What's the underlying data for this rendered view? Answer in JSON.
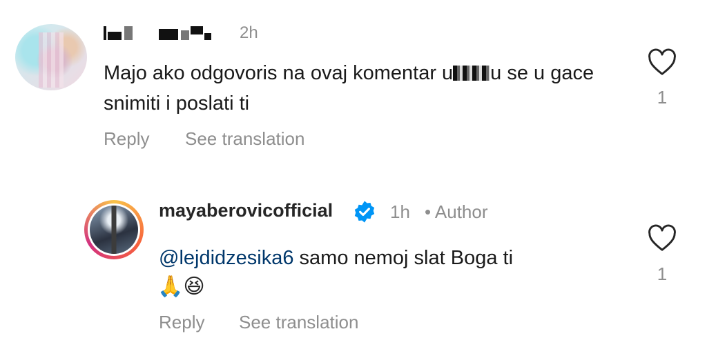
{
  "comment1": {
    "time": "2h",
    "text_part1": "Majo ako odgovoris na ovaj komentar u",
    "text_part2": "u se u gace snimiti i poslati ti",
    "reply_label": "Reply",
    "see_translation_label": "See translation",
    "like_count": "1",
    "avatar_icon": "blurred-avatar",
    "like_icon": "heart-outline-icon"
  },
  "comment2": {
    "username": "mayaberovicofficial",
    "time": "1h",
    "separator": "•",
    "author_label": "Author",
    "mention": "@lejdidzesika6",
    "text": " samo nemoj slat Boga ti",
    "emojis": "🙏😆",
    "reply_label": "Reply",
    "see_translation_label": "See translation",
    "like_count": "1",
    "verified_icon": "verified-badge-icon",
    "like_icon": "heart-outline-icon",
    "colors": {
      "verified": "#0095f6",
      "mention": "#00376b",
      "meta": "#8e8e8e"
    }
  }
}
